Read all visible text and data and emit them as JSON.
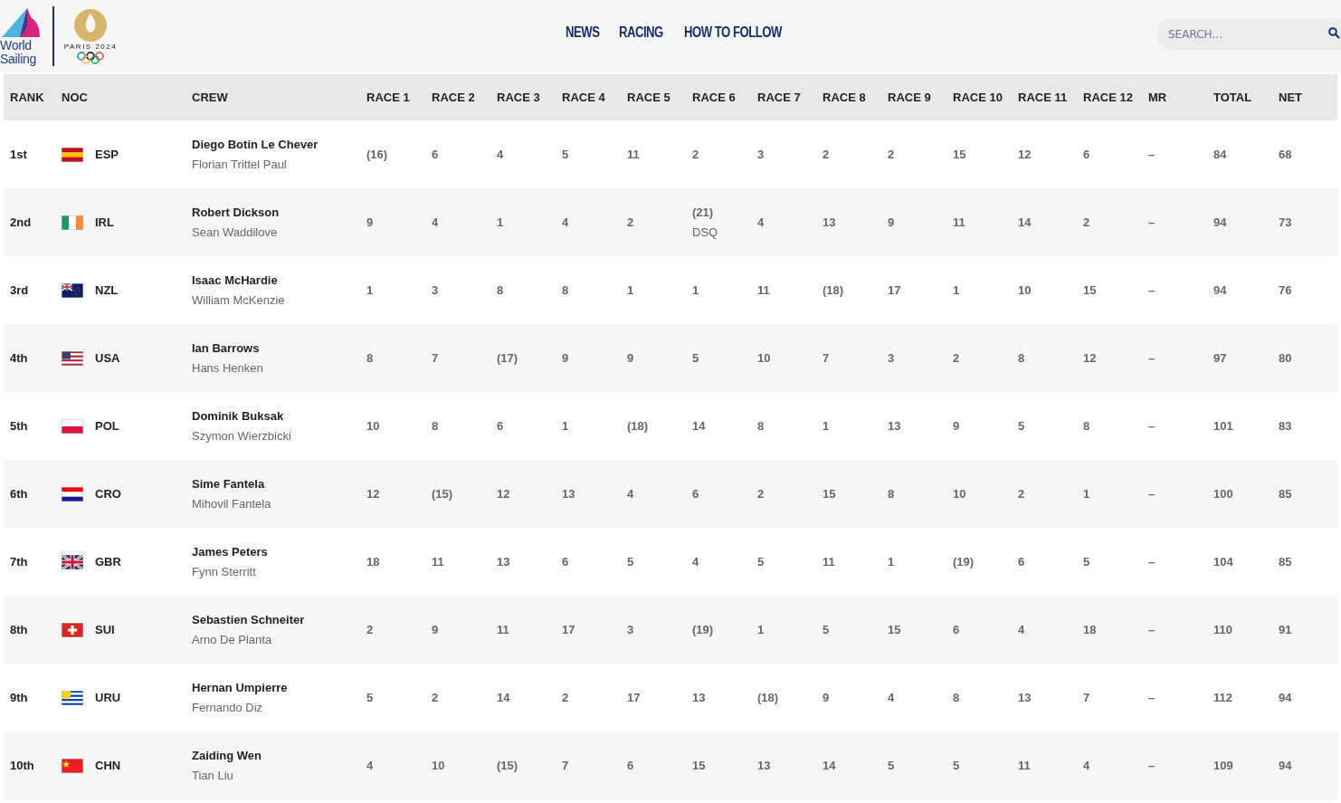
{
  "header": {
    "logo_text": [
      "World",
      "Sailing"
    ],
    "partner_text": "PARIS 2024",
    "nav": [
      "NEWS",
      "RACING",
      "HOW TO FOLLOW"
    ],
    "search": {
      "placeholder": "SEARCH..."
    }
  },
  "table": {
    "columns": [
      "RANK",
      "NOC",
      "CREW",
      "RACE 1",
      "RACE 2",
      "RACE 3",
      "RACE 4",
      "RACE 5",
      "RACE 6",
      "RACE 7",
      "RACE 8",
      "RACE 9",
      "RACE 10",
      "RACE 11",
      "RACE 12",
      "MR",
      "TOTAL",
      "NET"
    ],
    "rows": [
      {
        "rank": "1st",
        "noc": "ESP",
        "crew": [
          "Diego Botin Le Chever",
          "Florian Trittel Paul"
        ],
        "races": [
          "(16)",
          "6",
          "4",
          "5",
          "11",
          "2",
          "3",
          "2",
          "2",
          "15",
          "12",
          "6"
        ],
        "mr": "–",
        "total": "84",
        "net": "68"
      },
      {
        "rank": "2nd",
        "noc": "IRL",
        "crew": [
          "Robert Dickson",
          "Sean Waddilove"
        ],
        "races": [
          "9",
          "4",
          "1",
          "4",
          "2",
          {
            "value": "(21)",
            "note": "DSQ"
          },
          "4",
          "13",
          "9",
          "11",
          "14",
          "2"
        ],
        "mr": "–",
        "total": "94",
        "net": "73"
      },
      {
        "rank": "3rd",
        "noc": "NZL",
        "crew": [
          "Isaac McHardie",
          "William McKenzie"
        ],
        "races": [
          "1",
          "3",
          "8",
          "8",
          "1",
          "1",
          "11",
          "(18)",
          "17",
          "1",
          "10",
          "15"
        ],
        "mr": "–",
        "total": "94",
        "net": "76"
      },
      {
        "rank": "4th",
        "noc": "USA",
        "crew": [
          "Ian Barrows",
          "Hans Henken"
        ],
        "races": [
          "8",
          "7",
          "(17)",
          "9",
          "9",
          "5",
          "10",
          "7",
          "3",
          "2",
          "8",
          "12"
        ],
        "mr": "–",
        "total": "97",
        "net": "80"
      },
      {
        "rank": "5th",
        "noc": "POL",
        "crew": [
          "Dominik Buksak",
          "Szymon Wierzbicki"
        ],
        "races": [
          "10",
          "8",
          "6",
          "1",
          "(18)",
          "14",
          "8",
          "1",
          "13",
          "9",
          "5",
          "8"
        ],
        "mr": "–",
        "total": "101",
        "net": "83"
      },
      {
        "rank": "6th",
        "noc": "CRO",
        "crew": [
          "Sime Fantela",
          "Mihovil Fantela"
        ],
        "races": [
          "12",
          "(15)",
          "12",
          "13",
          "4",
          "6",
          "2",
          "15",
          "8",
          "10",
          "2",
          "1"
        ],
        "mr": "–",
        "total": "100",
        "net": "85"
      },
      {
        "rank": "7th",
        "noc": "GBR",
        "crew": [
          "James Peters",
          "Fynn Sterritt"
        ],
        "races": [
          "18",
          "11",
          "13",
          "6",
          "5",
          "4",
          "5",
          "11",
          "1",
          "(19)",
          "6",
          "5"
        ],
        "mr": "–",
        "total": "104",
        "net": "85"
      },
      {
        "rank": "8th",
        "noc": "SUI",
        "crew": [
          "Sebastien Schneiter",
          "Arno De Planta"
        ],
        "races": [
          "2",
          "9",
          "11",
          "17",
          "3",
          "(19)",
          "1",
          "5",
          "15",
          "6",
          "4",
          "18"
        ],
        "mr": "–",
        "total": "110",
        "net": "91"
      },
      {
        "rank": "9th",
        "noc": "URU",
        "crew": [
          "Hernan Umpierre",
          "Fernando Diz"
        ],
        "races": [
          "5",
          "2",
          "14",
          "2",
          "17",
          "13",
          "(18)",
          "9",
          "4",
          "8",
          "13",
          "7"
        ],
        "mr": "–",
        "total": "112",
        "net": "94"
      },
      {
        "rank": "10th",
        "noc": "CHN",
        "crew": [
          "Zaiding Wen",
          "Tian Liu"
        ],
        "races": [
          "4",
          "10",
          "(15)",
          "7",
          "6",
          "15",
          "13",
          "14",
          "5",
          "5",
          "11",
          "4"
        ],
        "mr": "–",
        "total": "109",
        "net": "94"
      }
    ]
  }
}
